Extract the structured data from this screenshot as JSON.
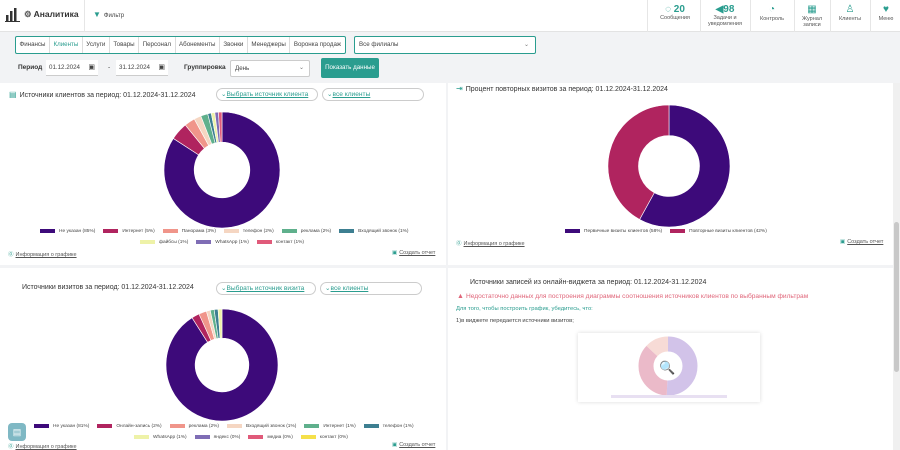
{
  "header": {
    "app_title": "Аналитика",
    "filter_label": "Фильтр",
    "items": [
      {
        "value": "20",
        "label": "Сообщения",
        "icon": "chat-icon"
      },
      {
        "value": "98",
        "label": "Задачи и уведомления",
        "icon": "megaphone-icon"
      },
      {
        "label": "Контроль",
        "icon": "gauge-icon"
      },
      {
        "label": "Журнал записи",
        "icon": "calendar-icon"
      },
      {
        "label": "Клиенты",
        "icon": "user-icon"
      },
      {
        "label": "Меню",
        "icon": "heart-icon"
      }
    ]
  },
  "tabs": [
    "Финансы",
    "Клиенты",
    "Услуги",
    "Товары",
    "Персонал",
    "Абонементы",
    "Звонки",
    "Менеджеры",
    "Воронка продаж"
  ],
  "active_tab": "Клиенты",
  "branch_select": "Все филиалы",
  "period": {
    "label": "Период",
    "from": "01.12.2024",
    "to": "31.12.2024",
    "dash": "-"
  },
  "grouping": {
    "label": "Группировка",
    "value": "День"
  },
  "show_button": "Показать данные",
  "panels": {
    "client_sources": {
      "title": "Источники клиентов за период: 01.12.2024-31.12.2024",
      "select_source": "Выбрать источник клиента",
      "all_clients": "все клиенты",
      "info": "Информация о графике",
      "report": "Создать отчет",
      "legend": [
        {
          "label": "Не указан (85%)",
          "color": "#3d0a7a"
        },
        {
          "label": "Интернет (5%)",
          "color": "#b0245f"
        },
        {
          "label": "Панорама (3%)",
          "color": "#f0958a"
        },
        {
          "label": "телефон (2%)",
          "color": "#f5d6c2"
        },
        {
          "label": "реклама (2%)",
          "color": "#5fb08c"
        },
        {
          "label": "Входящий звонок (1%)",
          "color": "#3d7f91"
        },
        {
          "label": "файбсы (1%)",
          "color": "#eef2a8"
        },
        {
          "label": "WhatsApp (1%)",
          "color": "#7f6db5"
        },
        {
          "label": "контакт (1%)",
          "color": "#e05a7a"
        }
      ]
    },
    "repeat_visits": {
      "title": "Процент повторных визитов за период: 01.12.2024-31.12.2024",
      "info": "Информация о графике",
      "report": "Создать отчет",
      "legend": [
        {
          "label": "Первичные визиты клиентов (58%)",
          "color": "#3d0a7a"
        },
        {
          "label": "Повторные визиты клиентов (42%)",
          "color": "#b0245f"
        }
      ]
    },
    "visit_sources": {
      "title": "Источники визитов за период: 01.12.2024-31.12.2024",
      "select_source": "Выбрать источник визита",
      "all_clients": "все клиенты",
      "info": "Информация о графике",
      "report": "Создать отчет",
      "legend": [
        {
          "label": "Не указан (81%)",
          "color": "#3d0a7a"
        },
        {
          "label": "Онлайн-запись (2%)",
          "color": "#b0245f"
        },
        {
          "label": "реклама (2%)",
          "color": "#f0958a"
        },
        {
          "label": "Входящий звонок (1%)",
          "color": "#f5d6c2"
        },
        {
          "label": "Интернет (1%)",
          "color": "#5fb08c"
        },
        {
          "label": "телефон (1%)",
          "color": "#3d7f91"
        },
        {
          "label": "WhatsApp (1%)",
          "color": "#eef2a8"
        },
        {
          "label": "яндекс (0%)",
          "color": "#7f6db5"
        },
        {
          "label": "медиа (0%)",
          "color": "#e05a7a"
        },
        {
          "label": "контакт (0%)",
          "color": "#f5e04a"
        }
      ]
    },
    "widget_sources": {
      "title": "Источники записей из онлайн-виджета за период: 01.12.2024-31.12.2024",
      "warning": "Недостаточно данных для построения диаграммы соотношения источников клиентов по выбранным фильтрам",
      "hint": "Для того, чтобы построить график, убедитесь, что:",
      "hint_item": "1)в виджете передается источники визитов;"
    }
  },
  "chart_data": [
    {
      "type": "pie",
      "title": "Источники клиентов за период: 01.12.2024-31.12.2024",
      "categories": [
        "Не указан",
        "Интернет",
        "Панорама",
        "телефон",
        "реклама",
        "Входящий звонок",
        "файбсы",
        "WhatsApp",
        "контакт"
      ],
      "values": [
        85,
        5,
        3,
        2,
        2,
        1,
        1,
        1,
        1
      ],
      "legend": "bottom"
    },
    {
      "type": "pie",
      "title": "Процент повторных визитов за период: 01.12.2024-31.12.2024",
      "categories": [
        "Первичные визиты клиентов",
        "Повторные визиты клиентов"
      ],
      "values": [
        58,
        42
      ],
      "legend": "bottom"
    },
    {
      "type": "pie",
      "title": "Источники визитов за период: 01.12.2024-31.12.2024",
      "categories": [
        "Не указан",
        "Онлайн-запись",
        "реклама",
        "Входящий звонок",
        "Интернет",
        "телефон",
        "WhatsApp",
        "яндекс",
        "медиа",
        "контакт"
      ],
      "values": [
        81,
        2,
        2,
        1,
        1,
        1,
        1,
        0,
        0,
        0
      ],
      "legend": "bottom"
    }
  ]
}
